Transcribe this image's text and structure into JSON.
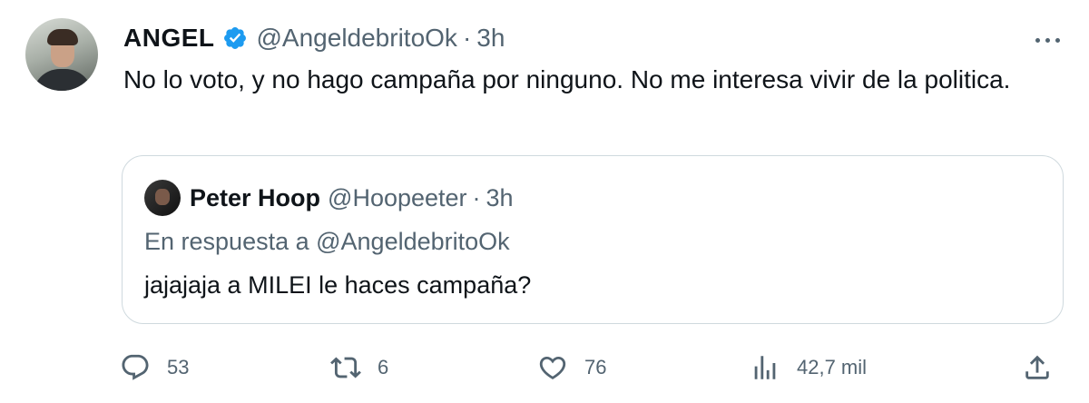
{
  "tweet": {
    "author_name": "ANGEL",
    "handle": "@AngeldebritoOk",
    "separator": "·",
    "time": "3h",
    "text": "No lo voto, y no hago campaña por ninguno. No me interesa vivir de la politica.",
    "verified_icon": "verified-badge-icon",
    "more_icon": "more-options-icon"
  },
  "quote": {
    "author_name": "Peter Hoop",
    "handle": "@Hoopeeter",
    "separator": "·",
    "time": "3h",
    "reply_line": "En respuesta a @AngeldebritoOk",
    "text": "jajajaja a MILEI le haces campaña?"
  },
  "actions": {
    "replies": "53",
    "retweets": "6",
    "likes": "76",
    "views": "42,7 mil"
  },
  "colors": {
    "text": "#0f1419",
    "secondary": "#536471",
    "verified": "#1d9bf0",
    "border": "#cfd9de"
  }
}
